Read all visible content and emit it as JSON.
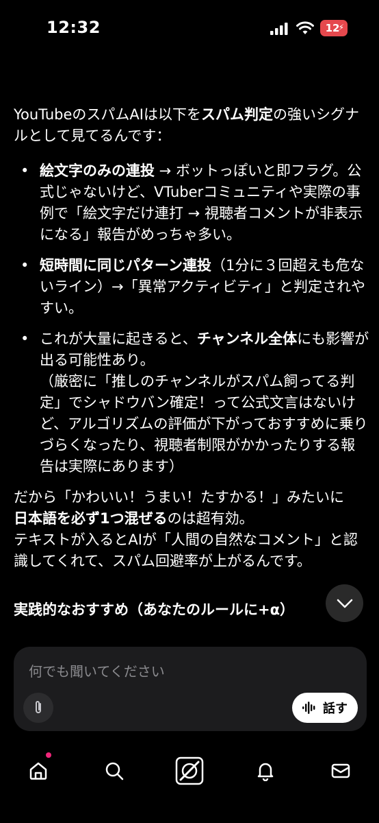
{
  "status_bar": {
    "time": "12:32",
    "battery": "12"
  },
  "content": {
    "intro_prefix": "YouTubeのスパムAIは以下を",
    "intro_bold": "スパム判定",
    "intro_suffix": "の強いシグナルとして見てるんです：",
    "bullets": [
      {
        "bold": "絵文字のみの連投",
        "text": " → ボットっぽいと即フラグ。公式じゃないけど、VTuberコミュニティや実際の事例で「絵文字だけ連打 → 視聴者コメントが非表示になる」報告がめっちゃ多い。"
      },
      {
        "bold": "短時間に同じパターン連投",
        "text": "（1分に３回超えも危ないライン）→「異常アクティビティ」と判定されやすい。"
      },
      {
        "prefix": "これが大量に起きると、",
        "bold": "チャンネル全体",
        "text": "にも影響が出る可能性あり。",
        "note": "（厳密に「推しのチャンネルがスパム飼ってる判定」でシャドウバン確定！って公式文言はないけど、アルゴリズムの評価が下がっておすすめに乗りづらくなったり、視聴者制限がかかったりする報告は実際にあります）"
      }
    ],
    "closing_prefix": "だから「かわいい！うまい！たすかる！」みたいに",
    "closing_bold": "日本語を必ず1つ混ぜる",
    "closing_suffix": "のは超有効。",
    "closing_line2": "テキストが入るとAIが「人間の自然なコメント」と認識してくれて、スパム回避率が上がるんです。",
    "section_heading": "実践的なおすすめ（あなたのルールに+α）"
  },
  "composer": {
    "placeholder": "何でも聞いてください",
    "speak_label": "話す"
  },
  "tab_bar": {
    "items": [
      "home-icon",
      "search-icon",
      "grok-icon",
      "bell-icon",
      "mail-icon"
    ]
  }
}
